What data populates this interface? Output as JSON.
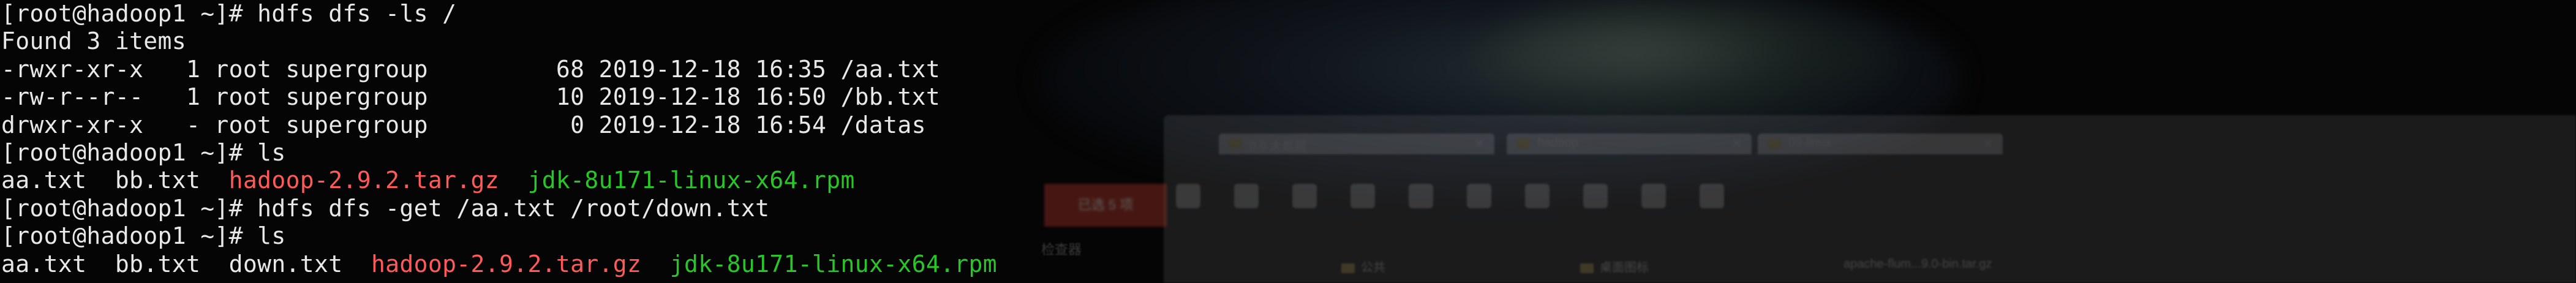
{
  "terminal": {
    "lines": [
      {
        "segments": [
          {
            "text": "[root@hadoop1 ~]# hdfs dfs -ls /"
          }
        ]
      },
      {
        "segments": [
          {
            "text": "Found 3 items"
          }
        ]
      },
      {
        "segments": [
          {
            "text": "-rwxr-xr-x   1 root supergroup         68 2019-12-18 16:35 /aa.txt"
          }
        ]
      },
      {
        "segments": [
          {
            "text": "-rw-r--r--   1 root supergroup         10 2019-12-18 16:50 /bb.txt"
          }
        ]
      },
      {
        "segments": [
          {
            "text": "drwxr-xr-x   - root supergroup          0 2019-12-18 16:54 /datas"
          }
        ]
      },
      {
        "segments": [
          {
            "text": "[root@hadoop1 ~]# ls"
          }
        ]
      },
      {
        "segments": [
          {
            "text": "aa.txt  bb.txt  "
          },
          {
            "text": "hadoop-2.9.2.tar.gz",
            "color": "red"
          },
          {
            "text": "  "
          },
          {
            "text": "jdk-8u171-linux-x64.rpm",
            "color": "green"
          }
        ]
      },
      {
        "segments": [
          {
            "text": "[root@hadoop1 ~]# hdfs dfs -get /aa.txt /root/down.txt"
          }
        ]
      },
      {
        "segments": [
          {
            "text": "[root@hadoop1 ~]# ls"
          }
        ]
      },
      {
        "segments": [
          {
            "text": "aa.txt  bb.txt  down.txt  "
          },
          {
            "text": "hadoop-2.9.2.tar.gz",
            "color": "red"
          },
          {
            "text": "  "
          },
          {
            "text": "jdk-8u171-linux-x64.rpm",
            "color": "green"
          }
        ]
      }
    ]
  },
  "colors": {
    "background": "#050505",
    "text": "#e8e8e8",
    "archive": "#ff5a5a",
    "package": "#28c628"
  },
  "background_window": {
    "tabs": [
      "0.0 大数据",
      "hadoop",
      "09-linux"
    ],
    "red_button": "已选 5 项",
    "label": "检查器",
    "panes": [
      "公共",
      "桌面图标",
      "apache-flum...9.0-bin.tar.gz"
    ]
  }
}
